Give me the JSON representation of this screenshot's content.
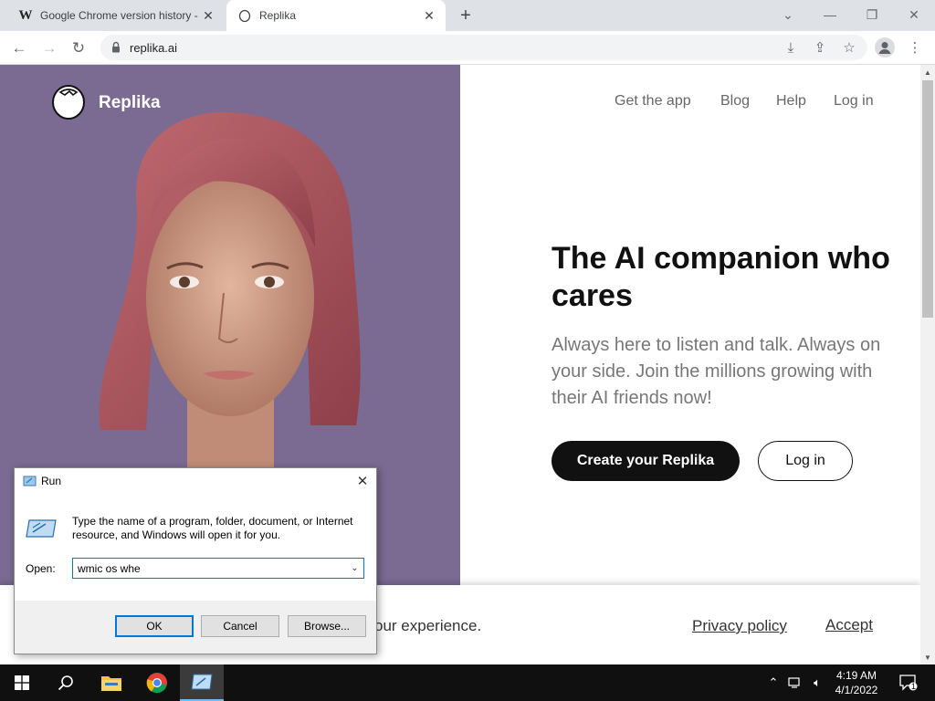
{
  "browser": {
    "tabs": [
      {
        "title": "Google Chrome version history -",
        "favicon": "W"
      },
      {
        "title": "Replika",
        "favicon": "egg"
      }
    ],
    "url": "replika.ai"
  },
  "page": {
    "logo_text": "Replika",
    "nav": [
      "Get the app",
      "Blog",
      "Help",
      "Log in"
    ],
    "headline": "The AI companion who cares",
    "subtext": "Always here to listen and talk. Always on your side. Join the millions growing with their AI friends now!",
    "cta_label": "Create your Replika",
    "login_label": "Log in",
    "cookie": {
      "text": "our experience.",
      "privacy_label": "Privacy policy",
      "accept_label": "Accept"
    },
    "hero_bg": "#7b6a92"
  },
  "run_dialog": {
    "title": "Run",
    "description": "Type the name of a program, folder, document, or Internet resource, and Windows will open it for you.",
    "open_label": "Open:",
    "open_value": "wmic os whe",
    "ok_label": "OK",
    "cancel_label": "Cancel",
    "browse_label": "Browse..."
  },
  "taskbar": {
    "time": "4:19 AM",
    "date": "4/1/2022",
    "notification_count": "1"
  }
}
